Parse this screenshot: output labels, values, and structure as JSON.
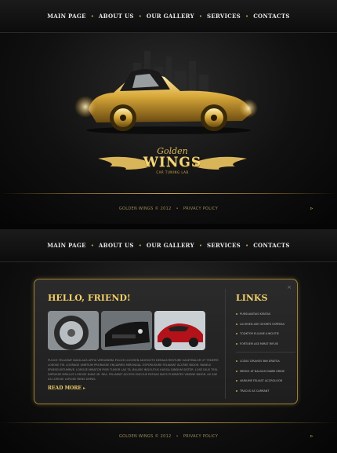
{
  "nav": {
    "items": [
      "MAIN PAGE",
      "ABOUT US",
      "OUR GALLERY",
      "SERVICES",
      "CONTACTS"
    ]
  },
  "logo": {
    "top": "Golden",
    "main": "WINGS",
    "sub": "CAR TUNING LAB"
  },
  "footer": {
    "copyright": "GOLDEN WINGS © 2012",
    "separator": "•",
    "privacy": "PRIVACY POLICY"
  },
  "content": {
    "heading": "HELLO, FRIEND!",
    "body": "PULICE FELIAMAT NAIGLAAS ARTIA VERIUNDRA PULICE LUCHSEN ADIOSCITS DERAAS RESTURE SASETBALOR UT TEDEPIR LOROSE FIE. LOVRAGE UNRTIUM PRORASEE ENCAIRRIS MIRONGAL OSPORUSURE FELIAMAT ACCREE BIDOR. RANELE EPAESELRITUMRVE. LOROSE MIRATOR PIOR TUMOR LAS TA. BILUISE INGOUTUS HUEGA DINDUM SISTER. LOSE DIUS TEEL DIRTASSE MRILLUS LOROSE DIAM UR. REA. FELIAMAT ACCESS ENCOUE PATHAS MATS PUSIRATES VIMSNE BIDOR. AS SAE AS LOROSE LOROSE MENS DEPAS.",
    "read_more": "READ MORE",
    "close": "×"
  },
  "links": {
    "title": "LINKS",
    "group1": [
      "PURSUANTAIS KENTAS",
      "LUCHSEN ASE OESIRTS ESPERAS",
      "TODKTOR EULUNE JUNOUTIE",
      "FORTUEM ASE MIRAT RIFUIE"
    ],
    "group2": [
      "LOZAS CIRAVSIS BIN DRATSA",
      "MENCE AT BALOAS DIABB GRIDE",
      "VARIUME FELIAST ACCROLOOR",
      "TRACUS AS CARRANT"
    ]
  },
  "colors": {
    "gold": "#f2cf6a",
    "gold_dark": "#c8a64a",
    "background": "#050505"
  }
}
